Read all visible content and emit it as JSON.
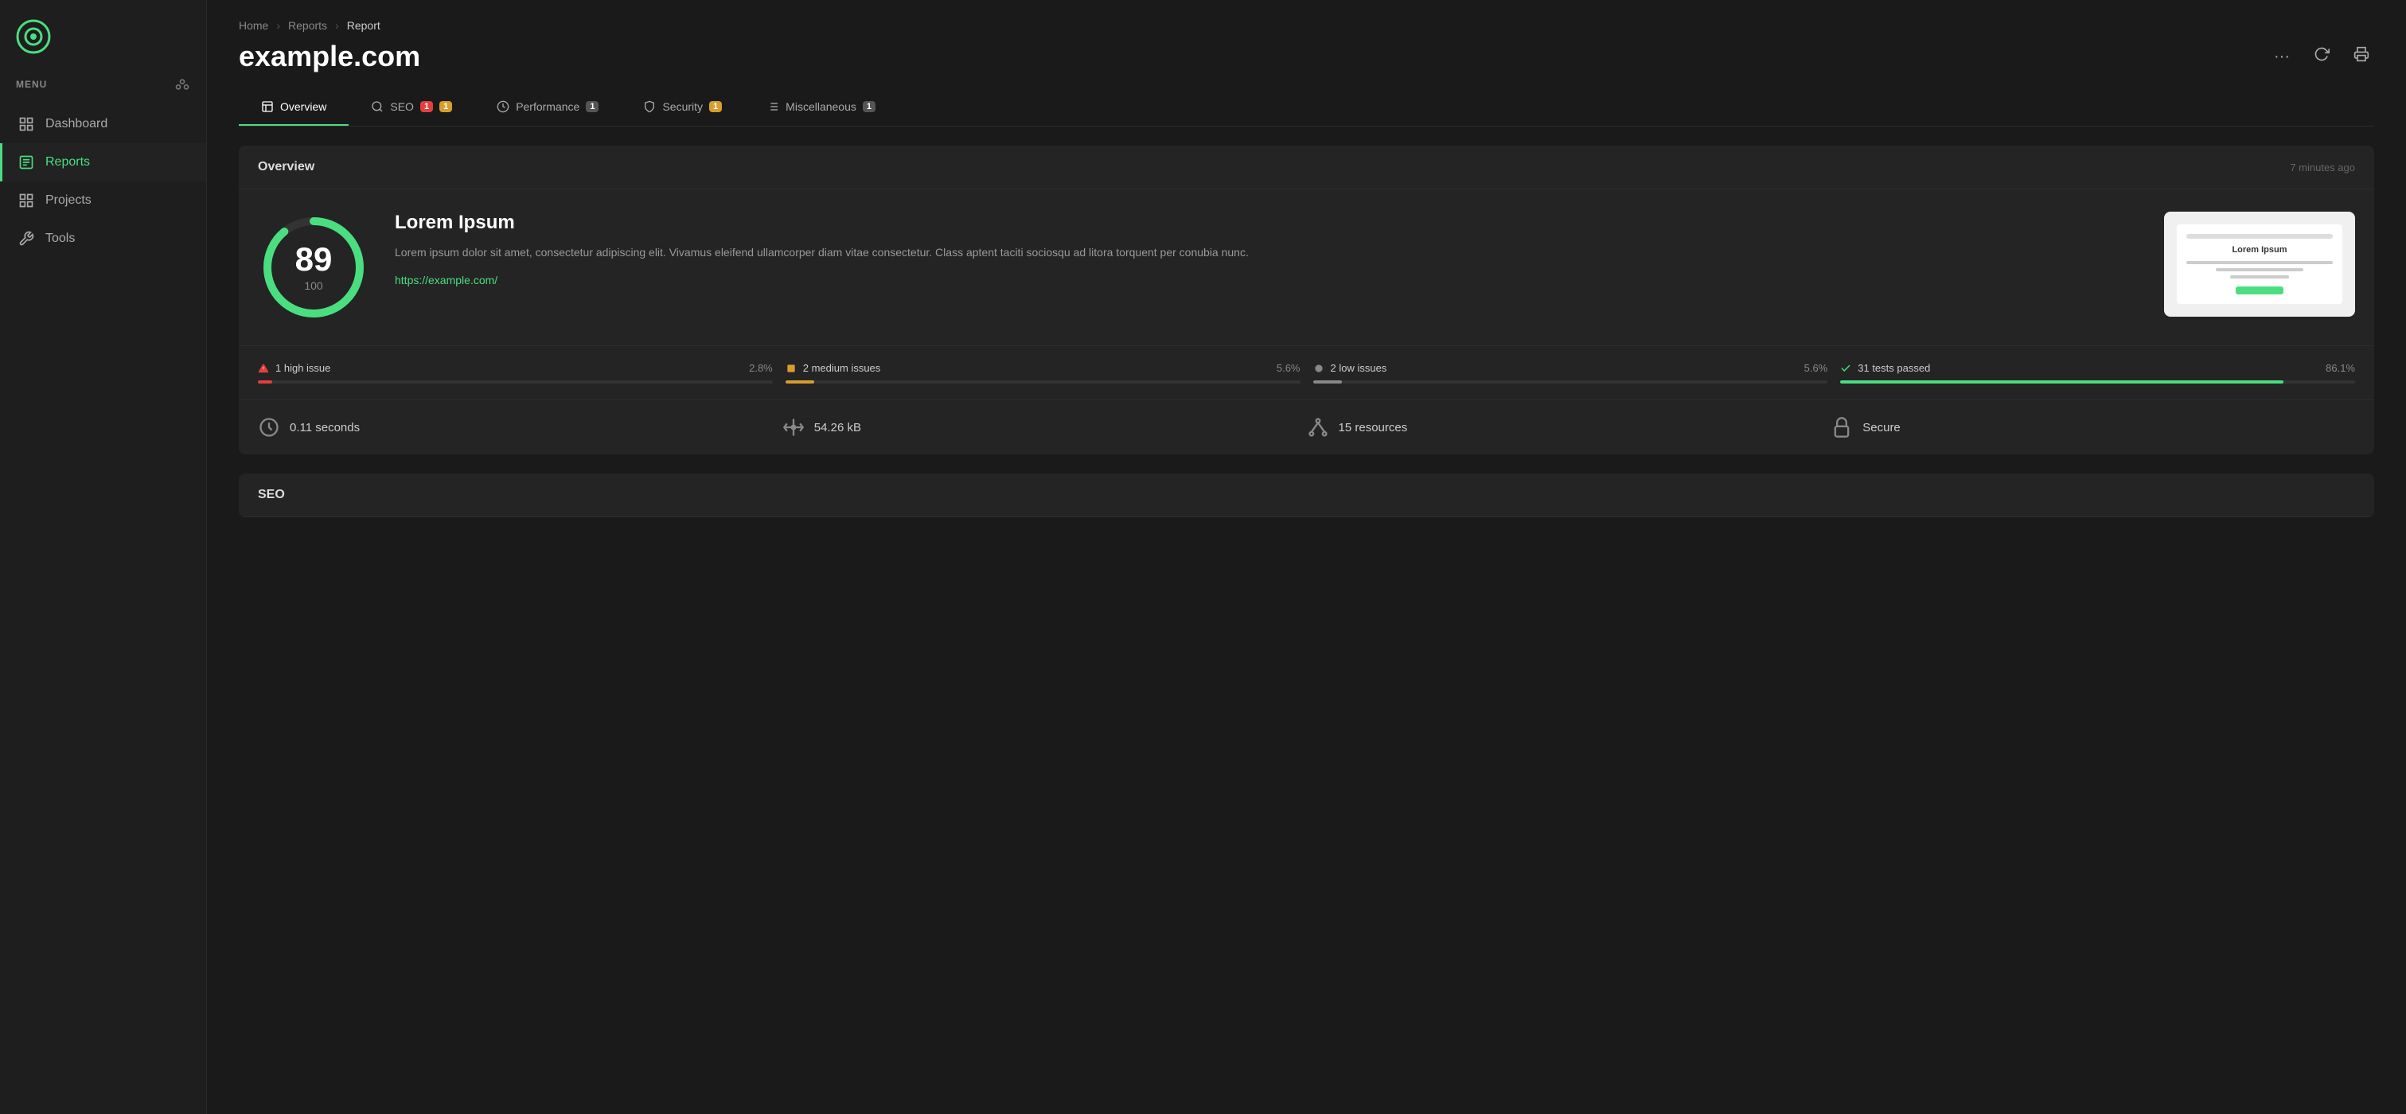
{
  "sidebar": {
    "menu_label": "MENU",
    "items": [
      {
        "id": "dashboard",
        "label": "Dashboard",
        "active": false
      },
      {
        "id": "reports",
        "label": "Reports",
        "active": true
      },
      {
        "id": "projects",
        "label": "Projects",
        "active": false
      },
      {
        "id": "tools",
        "label": "Tools",
        "active": false
      }
    ]
  },
  "header": {
    "breadcrumbs": [
      "Home",
      "Reports",
      "Report"
    ],
    "title": "example.com"
  },
  "tabs": [
    {
      "id": "overview",
      "label": "Overview",
      "active": true,
      "badges": []
    },
    {
      "id": "seo",
      "label": "SEO",
      "active": false,
      "badges": [
        {
          "value": "1",
          "color": "red"
        },
        {
          "value": "1",
          "color": "yellow"
        }
      ]
    },
    {
      "id": "performance",
      "label": "Performance",
      "active": false,
      "badges": [
        {
          "value": "1",
          "color": "gray"
        }
      ]
    },
    {
      "id": "security",
      "label": "Security",
      "active": false,
      "badges": [
        {
          "value": "1",
          "color": "yellow"
        }
      ]
    },
    {
      "id": "miscellaneous",
      "label": "Miscellaneous",
      "active": false,
      "badges": [
        {
          "value": "1",
          "color": "gray"
        }
      ]
    }
  ],
  "overview": {
    "section_title": "Overview",
    "time_ago": "7 minutes ago",
    "score": "89",
    "score_total": "100",
    "score_percent": 89,
    "site_name": "Lorem Ipsum",
    "description": "Lorem ipsum dolor sit amet, consectetur adipiscing elit. Vivamus eleifend ullamcorper diam vitae consectetur. Class aptent taciti sociosqu ad litora torquent per conubia nunc.",
    "url": "https://example.com/",
    "preview_title": "Lorem Ipsum",
    "issues": [
      {
        "label": "1 high issue",
        "pct": "2.8%",
        "pct_val": 2.8,
        "color": "red",
        "icon": "warning"
      },
      {
        "label": "2 medium issues",
        "pct": "5.6%",
        "pct_val": 5.6,
        "color": "yellow",
        "icon": "square"
      },
      {
        "label": "2 low issues",
        "pct": "5.6%",
        "pct_val": 5.6,
        "color": "gray",
        "icon": "circle"
      },
      {
        "label": "31 tests passed",
        "pct": "86.1%",
        "pct_val": 86.1,
        "color": "green",
        "icon": "check"
      }
    ],
    "stats": [
      {
        "icon": "clock",
        "value": "0.11 seconds"
      },
      {
        "icon": "scale",
        "value": "54.26 kB"
      },
      {
        "icon": "network",
        "value": "15 resources"
      },
      {
        "icon": "lock",
        "value": "Secure"
      }
    ]
  },
  "seo": {
    "section_title": "SEO"
  }
}
